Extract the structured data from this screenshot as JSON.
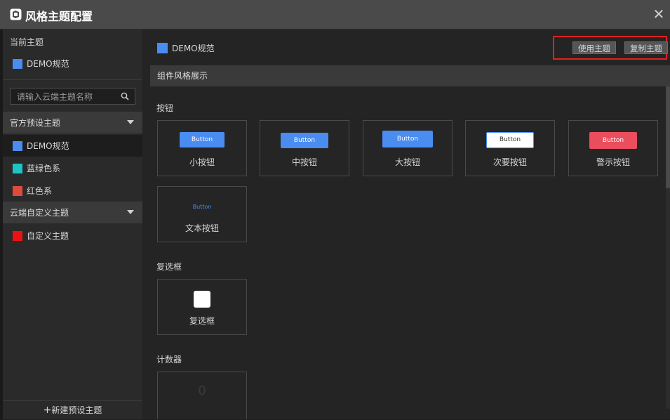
{
  "window": {
    "title": "风格主题配置",
    "close_icon": "close-icon"
  },
  "sidebar": {
    "current_label": "当前主题",
    "current_theme": {
      "name": "DEMO规范",
      "color": "#4a8cf0"
    },
    "search_placeholder": "请输入云端主题名称",
    "groups": [
      {
        "label": "官方预设主题",
        "items": [
          {
            "name": "DEMO规范",
            "color": "#4a8cf0",
            "selected": true
          },
          {
            "name": "蓝绿色系",
            "color": "#1cc4c4",
            "selected": false
          },
          {
            "name": "红色系",
            "color": "#e04a3a",
            "selected": false
          }
        ]
      },
      {
        "label": "云端自定义主题",
        "items": [
          {
            "name": "自定义主题",
            "color": "#ee1111",
            "selected": false
          }
        ]
      }
    ],
    "new_button": "新建预设主题"
  },
  "main": {
    "theme_name": "DEMO规范",
    "theme_color": "#4a8cf0",
    "use_theme": "使用主题",
    "copy_theme": "复制主题",
    "section_title": "组件风格展示",
    "buttons_label": "按钮",
    "button_cards": [
      {
        "caption": "小按钮",
        "btn_text": "Button",
        "style": "primary-small"
      },
      {
        "caption": "中按钮",
        "btn_text": "Button",
        "style": "primary-medium"
      },
      {
        "caption": "大按钮",
        "btn_text": "Button",
        "style": "primary-large"
      },
      {
        "caption": "次要按钮",
        "btn_text": "Button",
        "style": "secondary"
      },
      {
        "caption": "警示按钮",
        "btn_text": "Button",
        "style": "danger"
      },
      {
        "caption": "文本按钮",
        "btn_text": "Button",
        "style": "text"
      }
    ],
    "checkbox_label": "复选框",
    "checkbox_caption": "复选框",
    "counter_label": "计数器",
    "counter_value": "0",
    "colors": {
      "primary": "#4a8cf0",
      "danger": "#ea4d5c"
    }
  }
}
